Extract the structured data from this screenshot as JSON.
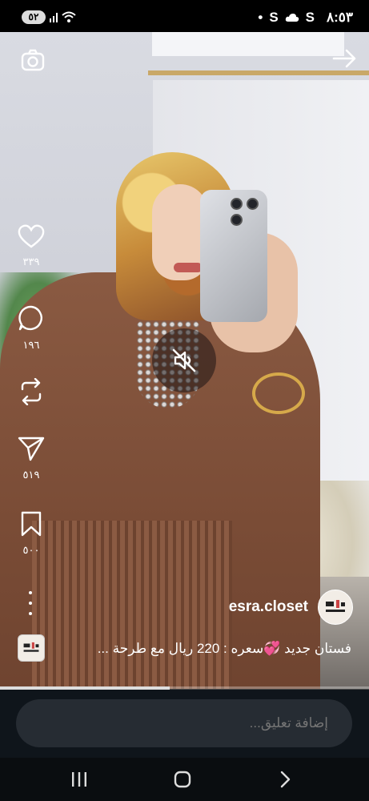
{
  "status_bar": {
    "time": "٨:٥٣",
    "battery": "٥٢",
    "carrier_icons": [
      "S",
      "cloud-icon",
      "S",
      "dot"
    ]
  },
  "reel": {
    "actions": {
      "likes": "٣٣٩",
      "comments": "١٩٦",
      "shares": "٥١٩",
      "saves": "٥٠٠"
    },
    "username": "esra.closet",
    "caption": "فستان جديد 💞سعره : 220 ريال مع طرحة ...",
    "progress": 0.46
  },
  "comment_bar": {
    "placeholder": "إضافة تعليق..."
  },
  "colors": {
    "background": "#000000",
    "bar": "#0f151b",
    "input": "#262c33"
  }
}
